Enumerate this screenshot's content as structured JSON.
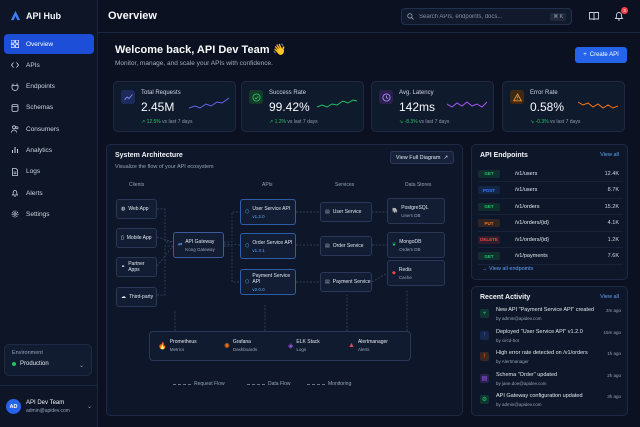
{
  "app": {
    "name": "API Hub",
    "page_title": "Overview"
  },
  "sidebar": {
    "items": [
      {
        "label": "Overview",
        "icon": "grid-icon",
        "active": true
      },
      {
        "label": "APIs",
        "icon": "code-icon"
      },
      {
        "label": "Endpoints",
        "icon": "plug-icon"
      },
      {
        "label": "Schemas",
        "icon": "database-icon"
      },
      {
        "label": "Consumers",
        "icon": "users-icon"
      },
      {
        "label": "Analytics",
        "icon": "bar-chart-icon"
      },
      {
        "label": "Logs",
        "icon": "file-icon"
      },
      {
        "label": "Alerts",
        "icon": "bell-icon"
      },
      {
        "label": "Settings",
        "icon": "gear-icon"
      }
    ],
    "environment": {
      "label": "Environment",
      "value": "Production"
    },
    "user": {
      "initials": "AD",
      "name": "API Dev Team",
      "email": "admin@apidev.com"
    }
  },
  "header": {
    "search_placeholder": "Search APIs, endpoints, docs...",
    "shortcut": "⌘ K",
    "notification_count": "3"
  },
  "welcome": {
    "title": "Welcome back, API Dev Team 👋",
    "subtitle": "Monitor, manage, and scale your APIs with confidence.",
    "create_label": "Create API"
  },
  "stats": [
    {
      "label": "Total Requests",
      "value": "2.45M",
      "delta": "↗ 12.5%",
      "period": "vs last 7 days",
      "color": "#6366f1"
    },
    {
      "label": "Success Rate",
      "value": "99.42%",
      "delta": "↗ 1.2%",
      "period": "vs last 7 days",
      "color": "#22c55e"
    },
    {
      "label": "Avg. Latency",
      "value": "142ms",
      "delta": "↘ -8.3%",
      "period": "vs last 7 days",
      "color": "#a855f7"
    },
    {
      "label": "Error Rate",
      "value": "0.58%",
      "delta": "↘ -0.3%",
      "period": "vs last 7 days",
      "color": "#f97316"
    }
  ],
  "architecture": {
    "title": "System Architecture",
    "subtitle": "Visualize the flow of your API ecosystem",
    "full_button": "View Full Diagram",
    "columns": {
      "clients": "Clients",
      "apis": "APIs",
      "services": "Services",
      "stores": "Data Stores"
    },
    "clients": [
      "Web App",
      "Mobile App",
      "Partner Apps",
      "Third-party"
    ],
    "gateway": {
      "name": "API Gateway",
      "sub": "Kong Gateway"
    },
    "apis": [
      {
        "name": "User Service API",
        "ver": "v1.2.0"
      },
      {
        "name": "Order Service API",
        "ver": "v1.3.1"
      },
      {
        "name": "Payment Service API",
        "ver": "v2.0.0"
      }
    ],
    "services": [
      "User Service",
      "Order Service",
      "Payment Service"
    ],
    "stores": [
      {
        "name": "PostgreSQL",
        "sub": "Users DB"
      },
      {
        "name": "MongoDB",
        "sub": "Orders DB"
      },
      {
        "name": "Redis",
        "sub": "Cache"
      }
    ],
    "monitoring": [
      {
        "name": "Prometheus",
        "sub": "Metrics"
      },
      {
        "name": "Grafana",
        "sub": "Dashboards"
      },
      {
        "name": "ELK Stack",
        "sub": "Logs"
      },
      {
        "name": "Alertmanager",
        "sub": "Alerts"
      }
    ],
    "legend": [
      "Request Flow",
      "Data Flow",
      "Monitoring"
    ]
  },
  "endpoints": {
    "title": "API Endpoints",
    "view_all": "View all",
    "rows": [
      {
        "method": "GET",
        "path": "/v1/users",
        "count": "12.4K",
        "color": "#22c55e"
      },
      {
        "method": "POST",
        "path": "/v1/users",
        "count": "8.7K",
        "color": "#3b82f6"
      },
      {
        "method": "GET",
        "path": "/v1/orders",
        "count": "15.2K",
        "color": "#22c55e"
      },
      {
        "method": "PUT",
        "path": "/v1/orders/{id}",
        "count": "4.1K",
        "color": "#f97316"
      },
      {
        "method": "DELETE",
        "path": "/v1/orders/{id}",
        "count": "1.2K",
        "color": "#ef4444"
      },
      {
        "method": "GET",
        "path": "/v1/payments",
        "count": "7.6K",
        "color": "#22c55e"
      }
    ],
    "view_all_endpoints": "→ View all endpoints"
  },
  "activity": {
    "title": "Recent Activity",
    "view_all": "View all",
    "rows": [
      {
        "text": "New API \"Payment Service API\" created",
        "by": "by admin@apidev.com",
        "time": "2m ago",
        "icon": "plus-icon",
        "color": "#22c55e"
      },
      {
        "text": "Deployed \"User Service API\" v1.2.0",
        "by": "by ci/cd-bot",
        "time": "15m ago",
        "icon": "upload-icon",
        "color": "#3b82f6"
      },
      {
        "text": "High error rate detected on /v1/orders",
        "by": "by Alertmanager",
        "time": "1h ago",
        "icon": "warning-icon",
        "color": "#f97316"
      },
      {
        "text": "Schema \"Order\" updated",
        "by": "by jane.doe@apidev.com",
        "time": "2h ago",
        "icon": "doc-icon",
        "color": "#a855f7"
      },
      {
        "text": "API Gateway configuration updated",
        "by": "by admin@apidev.com",
        "time": "3h ago",
        "icon": "gear-icon",
        "color": "#22c55e"
      }
    ]
  }
}
